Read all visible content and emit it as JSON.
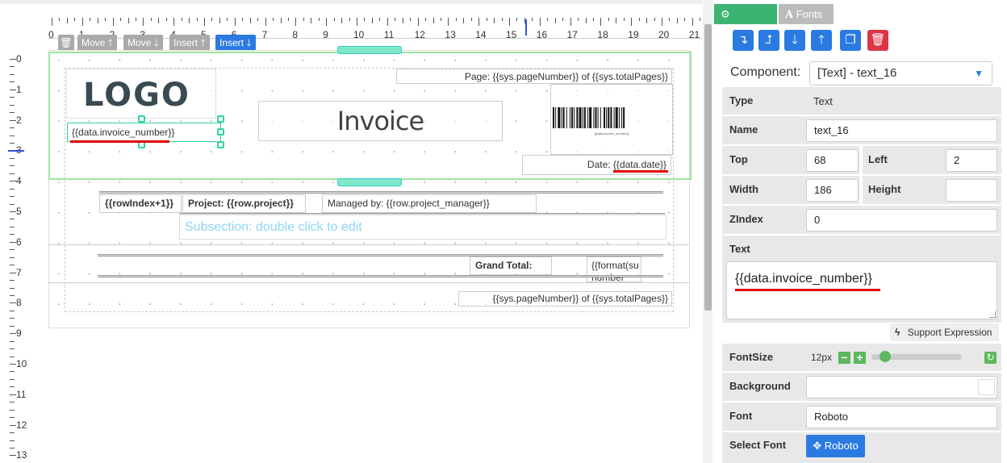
{
  "toolbar": {
    "move_up": "Move",
    "move_down": "Move",
    "insert_up": "Insert",
    "insert_down": "Insert"
  },
  "ruler": {
    "top_numbers": [
      "0",
      "1",
      "2",
      "3",
      "4",
      "5",
      "6",
      "7",
      "8",
      "9",
      "10",
      "11",
      "12",
      "13",
      "14",
      "15",
      "16",
      "17",
      "18",
      "19",
      "20",
      "21"
    ],
    "left_numbers": [
      "0",
      "1",
      "2",
      "3",
      "4",
      "5",
      "6",
      "7",
      "8",
      "9",
      "10",
      "11",
      "12",
      "13"
    ]
  },
  "canvas": {
    "logo_text": "LOGO",
    "page_text": "Page: {{sys.pageNumber}} of {{sys.totalPages}}",
    "invoice_number": "{{data.invoice_number}}",
    "invoice_title": "Invoice",
    "barcode_caption": "{{data.invoice_number}}",
    "date_label": "Date: ",
    "date_value": "{{data.date}}",
    "row_index": "{{rowIndex+1}}",
    "row_project": "Project: {{row.project}}",
    "row_manager": "Managed by: {{row.project_manager}}",
    "subsection": "Subsection: double click to edit",
    "grand_total": "Grand Total:",
    "format_text": "{{format(su",
    "format_text2": "number",
    "footer_page": "{{sys.pageNumber}} of {{sys.totalPages}}"
  },
  "panel": {
    "tab_general": "General",
    "tab_fonts": "Fonts",
    "component_label": "Component:",
    "component_value": "[Text] - text_16",
    "type_label": "Type",
    "type_value": "Text",
    "name_label": "Name",
    "name_value": "text_16",
    "top_label": "Top",
    "top_value": "68",
    "left_label": "Left",
    "left_value": "2",
    "width_label": "Width",
    "width_value": "186",
    "height_label": "Height",
    "height_value": "",
    "zindex_label": "ZIndex",
    "zindex_value": "0",
    "text_label": "Text",
    "text_value": "{{data.invoice_number}}",
    "support_expression": "Support Expression",
    "fontsize_label": "FontSize",
    "fontsize_value": "12px",
    "fontsize_level": 0.1,
    "background_label": "Background",
    "font_label": "Font",
    "font_value": "Roboto",
    "select_font_label": "Select Font",
    "select_font_button": "Roboto"
  },
  "colors": {
    "accent": "#2a7ae2",
    "danger": "#dc3545",
    "tab_active": "#3cb371",
    "band": "#9be59b",
    "highlight": "#e30000"
  }
}
